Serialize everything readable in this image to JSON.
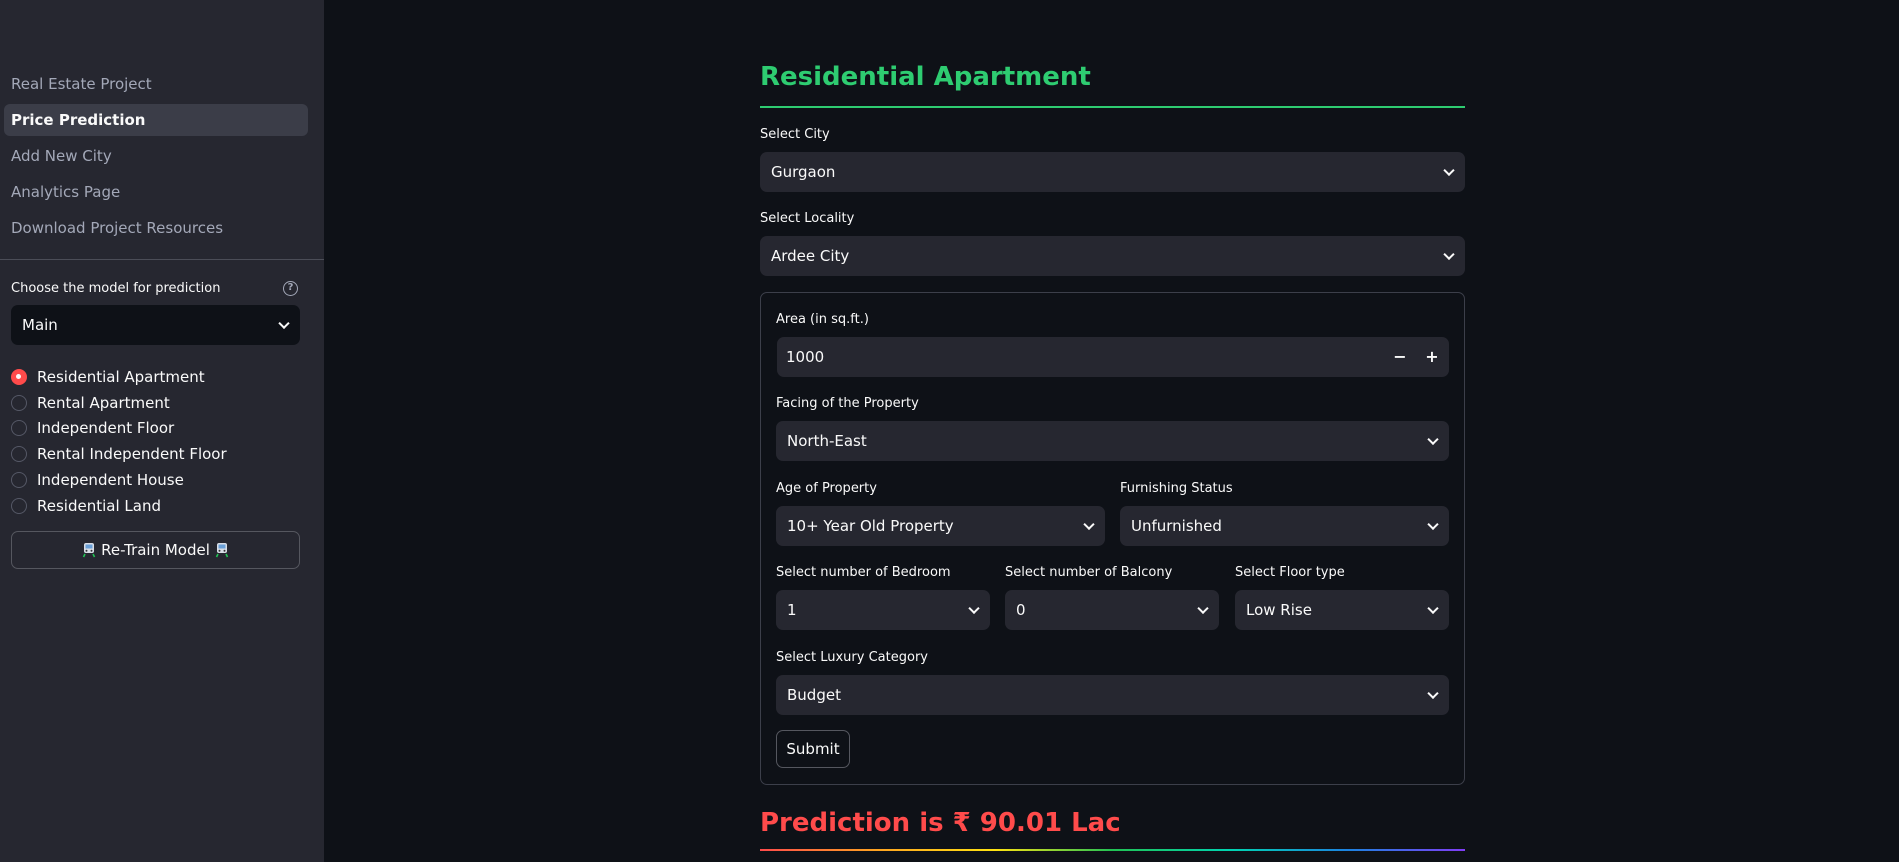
{
  "sidebar": {
    "nav": [
      {
        "label": "Real Estate Project",
        "active": false
      },
      {
        "label": "Price Prediction",
        "active": true
      },
      {
        "label": "Add New City",
        "active": false
      },
      {
        "label": "Analytics Page",
        "active": false
      },
      {
        "label": "Download Project Resources",
        "active": false
      }
    ],
    "model_label": "Choose the model for prediction",
    "help_icon": "question-circle-icon",
    "model_value": "Main",
    "property_types": [
      {
        "label": "Residential Apartment",
        "checked": true
      },
      {
        "label": "Rental Apartment",
        "checked": false
      },
      {
        "label": "Independent Floor",
        "checked": false
      },
      {
        "label": "Rental Independent Floor",
        "checked": false
      },
      {
        "label": "Independent House",
        "checked": false
      },
      {
        "label": "Residential Land",
        "checked": false
      }
    ],
    "retrain_label": "Re-Train Model",
    "retrain_icon": "train-icon"
  },
  "main": {
    "title": "Residential Apartment",
    "city": {
      "label": "Select City",
      "value": "Gurgaon"
    },
    "locality": {
      "label": "Select Locality",
      "value": "Ardee City"
    },
    "area": {
      "label": "Area (in sq.ft.)",
      "value": "1000",
      "minus": "−",
      "plus": "+"
    },
    "facing": {
      "label": "Facing of the Property",
      "value": "North-East"
    },
    "age": {
      "label": "Age of Property",
      "value": "10+ Year Old Property"
    },
    "furnishing": {
      "label": "Furnishing Status",
      "value": "Unfurnished"
    },
    "bedroom": {
      "label": "Select number of Bedroom",
      "value": "1"
    },
    "balcony": {
      "label": "Select number of Balcony",
      "value": "0"
    },
    "floor_type": {
      "label": "Select Floor type",
      "value": "Low Rise"
    },
    "luxury": {
      "label": "Select Luxury Category",
      "value": "Budget"
    },
    "submit_label": "Submit",
    "prediction": "Prediction is ₹ 90.01 Lac"
  },
  "colors": {
    "accent_red": "#ff4b4b",
    "title_green": "#2ecc71",
    "sidebar_bg": "#262730",
    "main_bg": "#0e1117"
  }
}
